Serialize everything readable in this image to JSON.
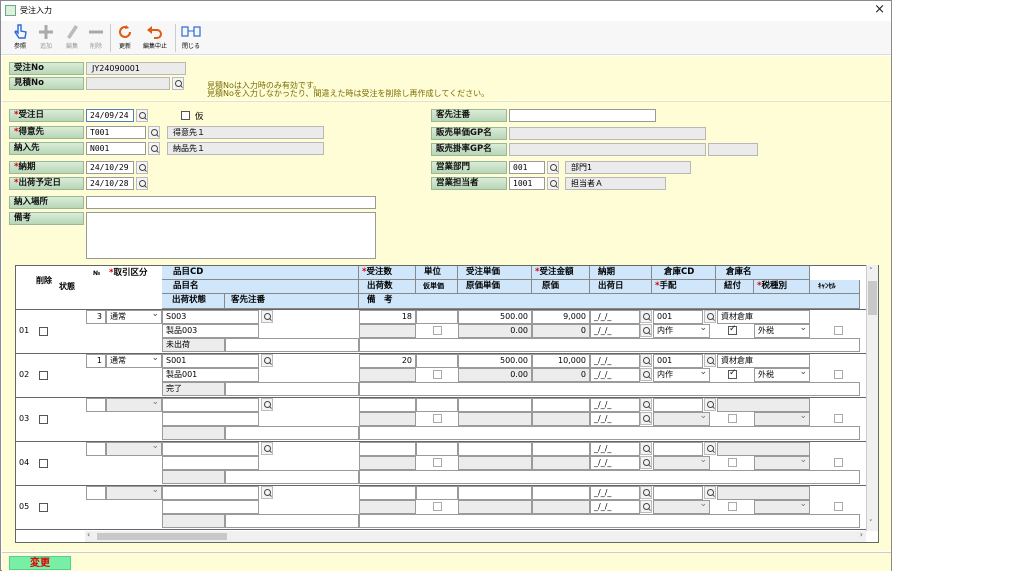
{
  "window": {
    "title": "受注入力",
    "close": "×"
  },
  "toolbar": {
    "ref": "参照",
    "add": "追加",
    "edit": "編集",
    "del": "削除",
    "refresh": "更新",
    "cancel_edit": "編集中止",
    "close": "閉じる"
  },
  "header": {
    "order_no_label": "受注No",
    "order_no": "JY24090001",
    "estimate_no_label": "見積No",
    "estimate_no": "",
    "note1": "見積Noは入力時のみ有効です。",
    "note2": "見積Noを入力しなかったり、間違えた時は受注を削除し再作成してください。"
  },
  "form": {
    "order_date_label": "受注日",
    "order_date": "24/09/24",
    "tentative_label": "仮",
    "customer_label": "得意先",
    "customer_code": "T001",
    "customer_name": "得意先１",
    "delivery_label": "納入先",
    "delivery_code": "N001",
    "delivery_name": "納品先１",
    "due_label": "納期",
    "due_date": "24/10/29",
    "ship_label": "出荷予定日",
    "ship_date": "24/10/28",
    "place_label": "納入場所",
    "place": "",
    "remarks_label": "備考",
    "remarks": "",
    "cust_order_label": "客先注番",
    "cust_order": "",
    "price_gp_label": "販売単価GP名",
    "price_gp": "",
    "rate_gp_label": "販売掛率GP名",
    "rate_gp": "",
    "rate_gp2": "",
    "dept_label": "営業部門",
    "dept_code": "001",
    "dept_name": "部門1",
    "staff_label": "営業担当者",
    "staff_code": "1001",
    "staff_name": "担当者Ａ"
  },
  "grid": {
    "headers": {
      "del": "削除",
      "state": "状態",
      "no": "№",
      "trade": "取引区分",
      "item_cd": "品目CD",
      "qty": "受注数",
      "unit": "単位",
      "price": "受注単価",
      "amount": "受注金額",
      "due": "納期",
      "wh_cd": "倉庫CD",
      "wh_name": "倉庫名",
      "item_name": "品目名",
      "ship_qty": "出荷数",
      "tent_price": "仮単価",
      "cost_price": "原価単価",
      "cost": "原価",
      "ship_date": "出荷日",
      "arrange": "手配",
      "link": "紐付",
      "tax": "税種別",
      "cancel": "ｷｬﾝｾﾙ",
      "ship_state": "出荷状態",
      "cust_order": "客先注番",
      "remarks": "備　考"
    },
    "rows": [
      {
        "rn": "01",
        "no": "3",
        "trade": "通常",
        "item_cd": "S003",
        "item_name": "製品003",
        "ship_state": "未出荷",
        "qty": "18",
        "price": "500.00",
        "amount": "9,000",
        "cost_price": "0.00",
        "cost": "0",
        "due": "_/_/_",
        "ship_date": "_/_/_",
        "wh_cd": "001",
        "wh_name": "資材倉庫",
        "arrange": "内作",
        "tax": "外税"
      },
      {
        "rn": "02",
        "no": "1",
        "trade": "通常",
        "item_cd": "S001",
        "item_name": "製品001",
        "ship_state": "完了",
        "qty": "20",
        "price": "500.00",
        "amount": "10,000",
        "cost_price": "0.00",
        "cost": "0",
        "due": "_/_/_",
        "ship_date": "_/_/_",
        "wh_cd": "001",
        "wh_name": "資材倉庫",
        "arrange": "内作",
        "tax": "外税"
      },
      {
        "rn": "03",
        "due": "_/_/_",
        "ship_date": "_/_/_"
      },
      {
        "rn": "04",
        "due": "_/_/_",
        "ship_date": "_/_/_"
      },
      {
        "rn": "05",
        "due": "_/_/_",
        "ship_date": "_/_/_"
      }
    ]
  },
  "status": {
    "mode": "変更"
  }
}
